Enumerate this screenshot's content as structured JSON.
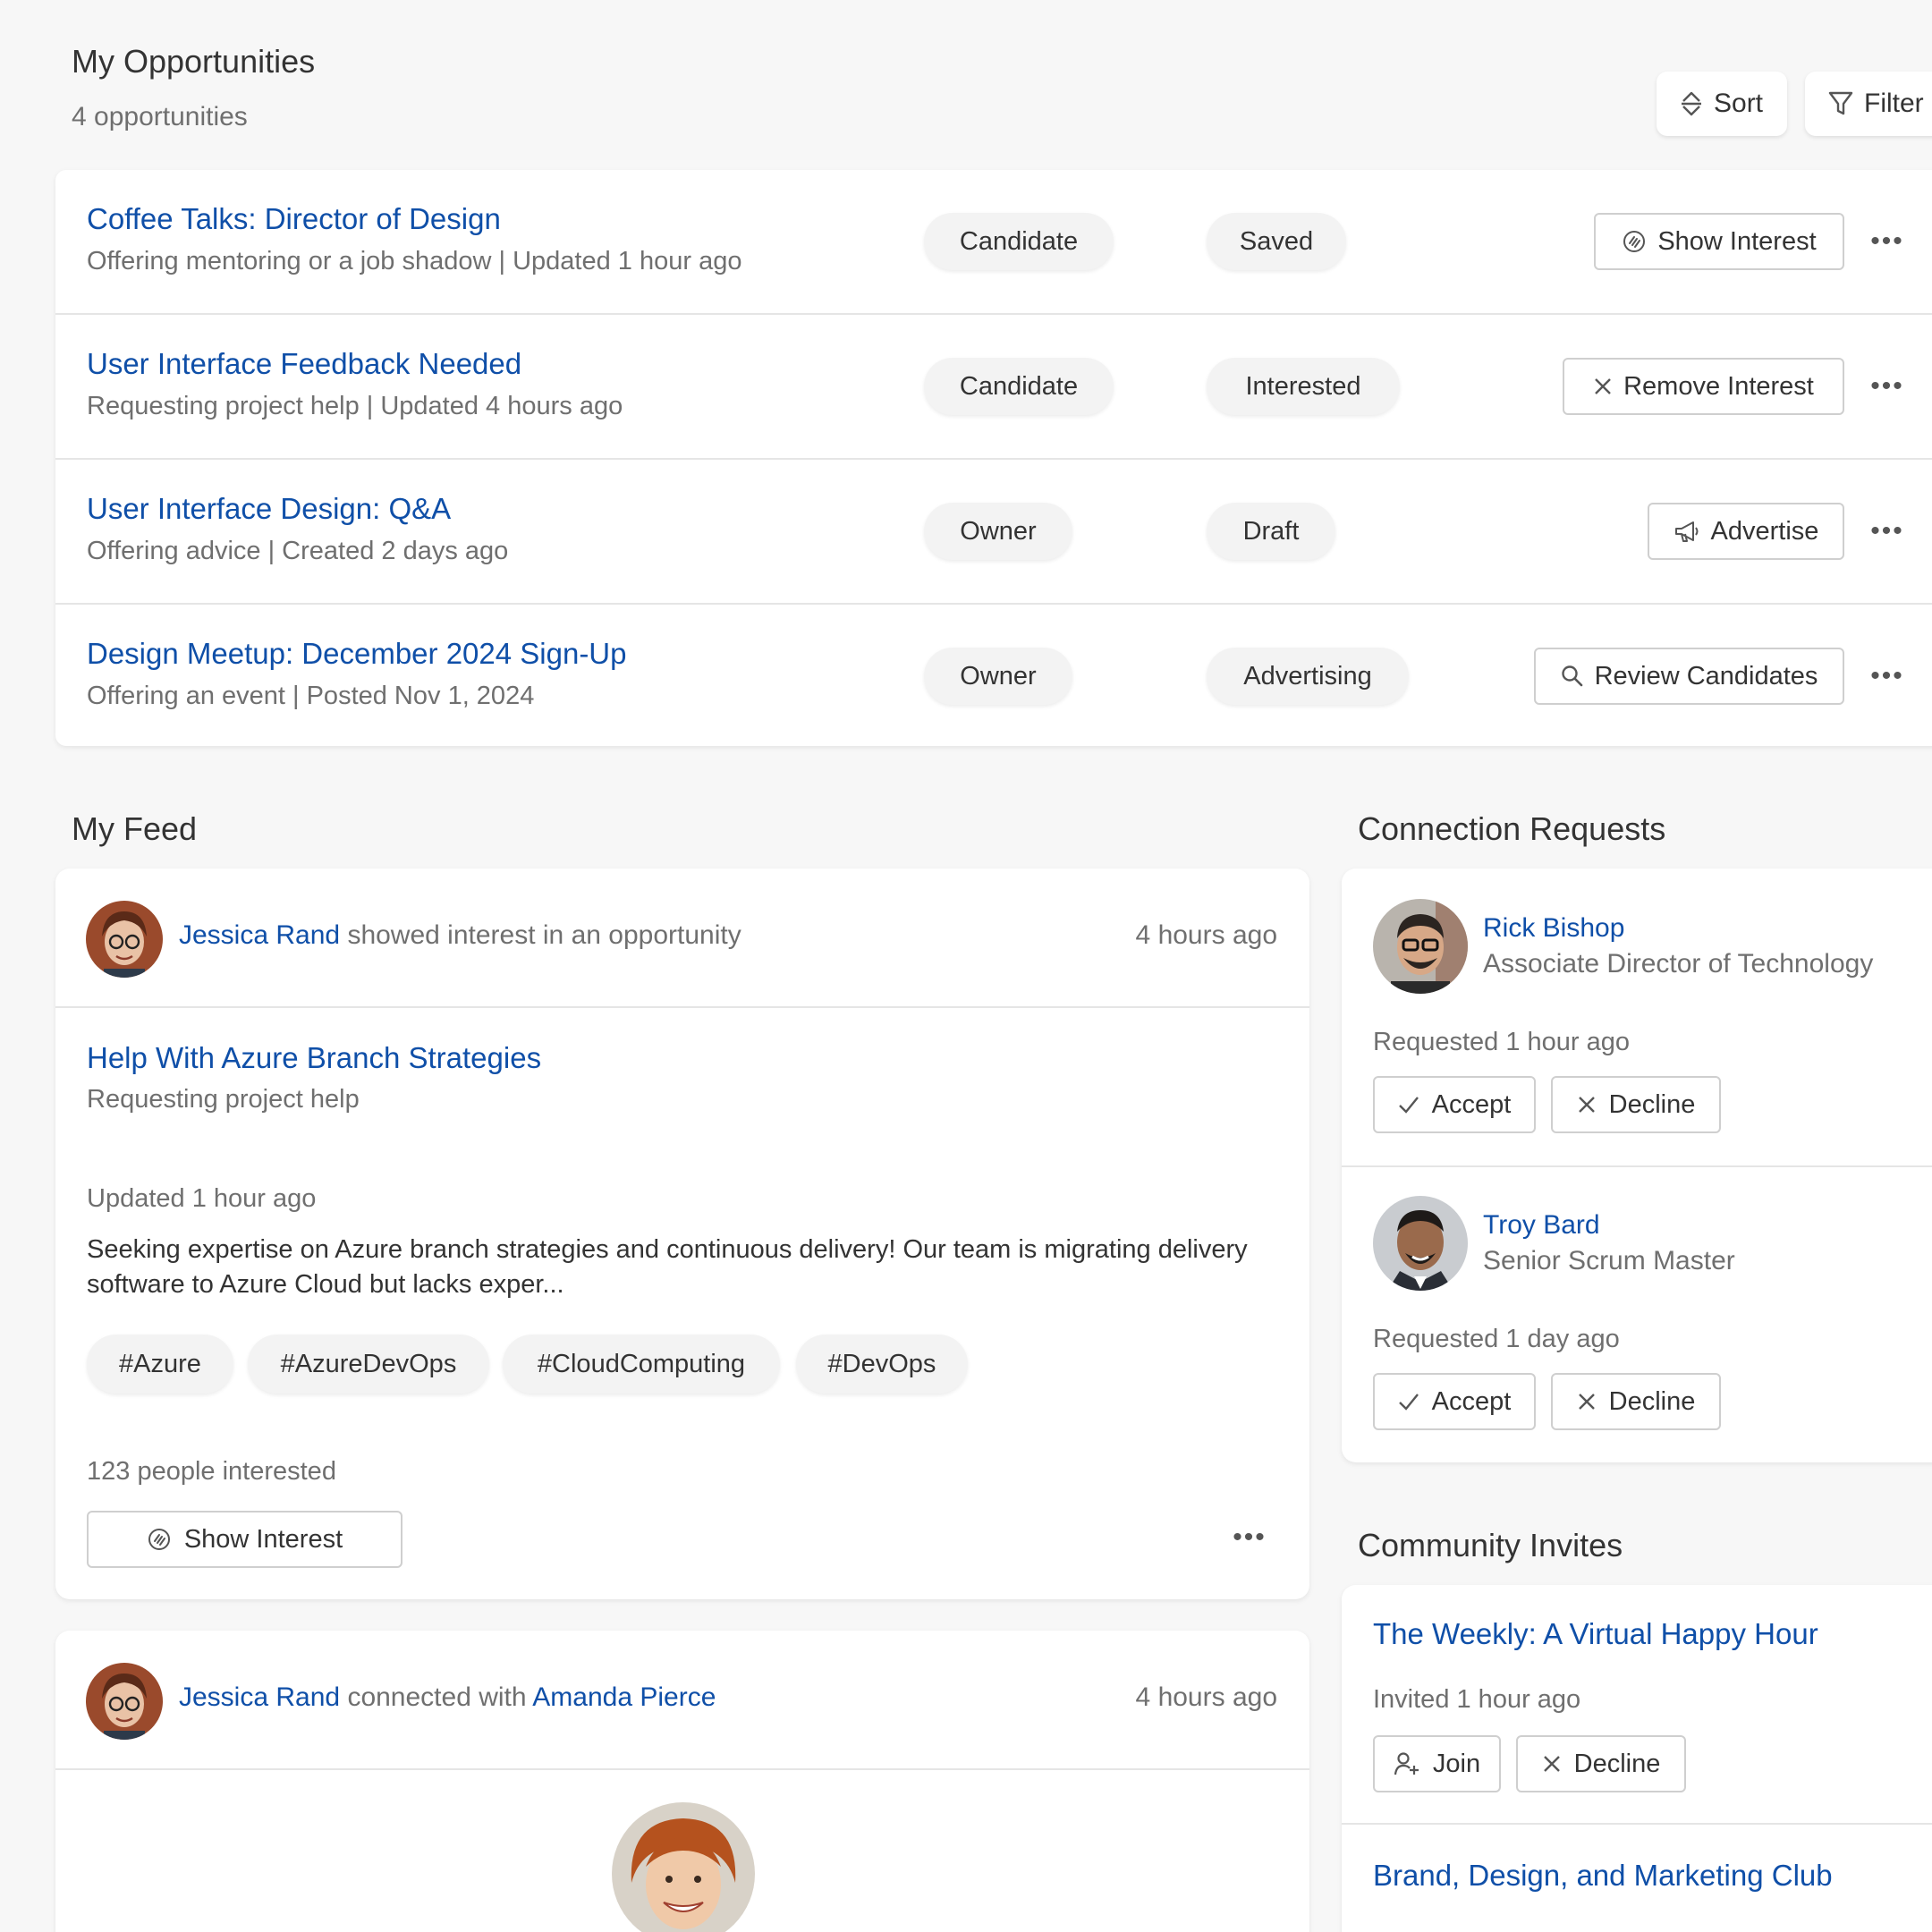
{
  "opportunities": {
    "title": "My Opportunities",
    "count": "4 opportunities",
    "sort_label": "Sort",
    "filter_label": "Filter",
    "rows": [
      {
        "title": "Coffee Talks: Director of Design",
        "subtitle": "Offering mentoring or a job shadow | Updated 1 hour ago",
        "role": "Candidate",
        "status": "Saved",
        "action": "Show Interest",
        "action_icon": "hand-icon"
      },
      {
        "title": "User Interface Feedback Needed",
        "subtitle": "Requesting project help | Updated 4 hours ago",
        "role": "Candidate",
        "status": "Interested",
        "action": "Remove Interest",
        "action_icon": "close-icon"
      },
      {
        "title": "User Interface Design: Q&A",
        "subtitle": "Offering advice | Created 2 days ago",
        "role": "Owner",
        "status": "Draft",
        "action": "Advertise",
        "action_icon": "megaphone-icon"
      },
      {
        "title": "Design Meetup: December 2024 Sign-Up",
        "subtitle": "Offering an event | Posted Nov 1, 2024",
        "role": "Owner",
        "status": "Advertising",
        "action": "Review Candidates",
        "action_icon": "search-icon"
      }
    ]
  },
  "feed": {
    "title": "My Feed",
    "items": [
      {
        "actor": "Jessica Rand",
        "activity": "showed interest in an opportunity",
        "time": "4 hours ago",
        "post_title": "Help With Azure Branch Strategies",
        "post_type": "Requesting project help",
        "updated": "Updated 1 hour ago",
        "body": "Seeking expertise on Azure branch strategies and continuous delivery! Our team is migrating delivery software to Azure Cloud but lacks exper...",
        "tags": [
          "#Azure",
          "#AzureDevOps",
          "#CloudComputing",
          "#DevOps"
        ],
        "interested": "123 people interested",
        "action": "Show Interest"
      },
      {
        "actor": "Jessica Rand",
        "activity": "connected with",
        "target": "Amanda Pierce",
        "time": "4 hours ago"
      }
    ]
  },
  "connections": {
    "title": "Connection Requests",
    "accept_label": "Accept",
    "decline_label": "Decline",
    "requests": [
      {
        "name": "Rick Bishop",
        "role": "Associate Director of Technology",
        "requested": "Requested 1 hour ago"
      },
      {
        "name": "Troy Bard",
        "role": "Senior Scrum Master",
        "requested": "Requested 1 day ago"
      }
    ]
  },
  "community": {
    "title": "Community Invites",
    "join_label": "Join",
    "decline_label": "Decline",
    "invites": [
      {
        "name": "The Weekly: A Virtual Happy Hour",
        "invited": "Invited 1 hour ago"
      },
      {
        "name": "Brand, Design, and Marketing Club"
      }
    ]
  },
  "colors": {
    "link": "#0f4fa8",
    "background": "#f7f7f7",
    "pill": "#f3f3f3"
  }
}
